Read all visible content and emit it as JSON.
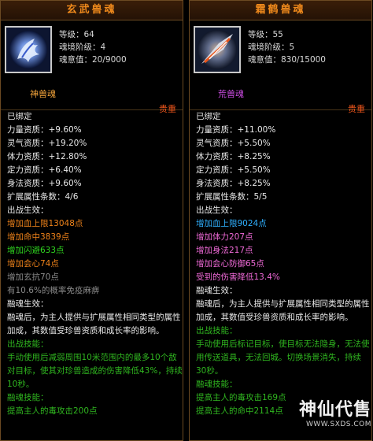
{
  "left": {
    "title": "玄武兽魂",
    "level": "等级：64",
    "stage": "魂境阶级：4",
    "will": "魂意值：20/9000",
    "type": "神兽魂",
    "precious": "贵重",
    "bound": "已绑定",
    "lines": [
      {
        "text": "力量资质：+9.60%",
        "cls": ""
      },
      {
        "text": "灵气资质：+19.20%",
        "cls": ""
      },
      {
        "text": "体力资质：+12.80%",
        "cls": ""
      },
      {
        "text": "定力资质：+6.40%",
        "cls": ""
      },
      {
        "text": "身法资质：+9.60%",
        "cls": ""
      },
      {
        "text": "扩展属性条数：4/6",
        "cls": ""
      },
      {
        "text": "出战生效：",
        "cls": ""
      },
      {
        "text": "增加血上限13048点",
        "cls": "o"
      },
      {
        "text": "增加命中3839点",
        "cls": "o"
      },
      {
        "text": "增加闪避633点",
        "cls": "g"
      },
      {
        "text": "增加会心74点",
        "cls": "o"
      },
      {
        "text": "增加玄抗70点",
        "cls": "gray"
      },
      {
        "text": "有10.6%的概率免疫麻痹",
        "cls": "gray"
      },
      {
        "text": "融魂生效：",
        "cls": ""
      },
      {
        "text": "融魂后，为主人提供与扩展属性相同类型的属性加成，其数值受珍兽资质和成长率的影响。",
        "cls": "wrap"
      },
      {
        "text": "出战技能：",
        "cls": "dk"
      },
      {
        "text": "手动使用后减弱周围10米范围内的最多10个敌对目标，使其对珍兽造成的伤害降低43%，持续10秒。",
        "cls": "dk wrap"
      },
      {
        "text": "融魂技能：",
        "cls": "dk"
      },
      {
        "text": "提高主人的毒攻击200点",
        "cls": "dk"
      }
    ]
  },
  "right": {
    "title": "霜鹤兽魂",
    "level": "等级：55",
    "stage": "魂境阶级：5",
    "will": "魂意值：830/15000",
    "type": "荒兽魂",
    "precious": "贵重",
    "bound": "已绑定",
    "lines": [
      {
        "text": "力量资质：+11.00%",
        "cls": ""
      },
      {
        "text": "灵气资质：+5.50%",
        "cls": ""
      },
      {
        "text": "体力资质：+8.25%",
        "cls": ""
      },
      {
        "text": "定力资质：+5.50%",
        "cls": ""
      },
      {
        "text": "身法资质：+8.25%",
        "cls": ""
      },
      {
        "text": "扩展属性条数：5/5",
        "cls": ""
      },
      {
        "text": "出战生效：",
        "cls": ""
      },
      {
        "text": "增加血上限9024点",
        "cls": "sky"
      },
      {
        "text": "增加体力207点",
        "cls": "pk"
      },
      {
        "text": "增加身法217点",
        "cls": "pk"
      },
      {
        "text": "增加会心防御65点",
        "cls": "pk"
      },
      {
        "text": "受到的伤害降低13.4%",
        "cls": "pk"
      },
      {
        "text": "融魂生效：",
        "cls": ""
      },
      {
        "text": "融魂后，为主人提供与扩展属性相同类型的属性加成，其数值受珍兽资质和成长率的影响。",
        "cls": "wrap"
      },
      {
        "text": "出战技能：",
        "cls": "dk"
      },
      {
        "text": "手动使用后标记目标，使目标无法隐身，无法使用传送道具，无法回城。切换场景消失，持续30秒。",
        "cls": "dk wrap"
      },
      {
        "text": "融魂技能：",
        "cls": "dk"
      },
      {
        "text": "提高主人的毒攻击169点",
        "cls": "dk"
      },
      {
        "text": "提高主人的命中2114点",
        "cls": "dk"
      }
    ]
  },
  "watermark": {
    "big": "神仙代售",
    "small": "WWW.SXDS.COM"
  }
}
